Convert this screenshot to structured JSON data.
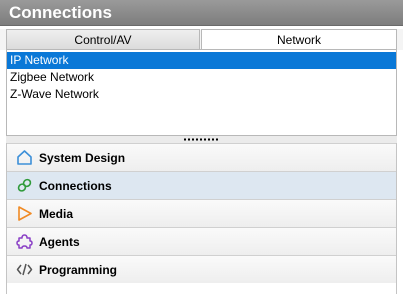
{
  "panel": {
    "title": "Connections"
  },
  "tabs": [
    {
      "label": "Control/AV",
      "active": false
    },
    {
      "label": "Network",
      "active": true
    }
  ],
  "network_list": [
    {
      "label": "IP Network",
      "selected": true
    },
    {
      "label": "Zigbee Network",
      "selected": false
    },
    {
      "label": "Z-Wave Network",
      "selected": false
    }
  ],
  "nav": [
    {
      "label": "System Design",
      "icon": "house-icon",
      "color": "#3c8fd8",
      "active": false
    },
    {
      "label": "Connections",
      "icon": "link-icon",
      "color": "#2f9a3a",
      "active": true
    },
    {
      "label": "Media",
      "icon": "play-icon",
      "color": "#f08a24",
      "active": false
    },
    {
      "label": "Agents",
      "icon": "puzzle-icon",
      "color": "#8a3fc6",
      "active": false
    },
    {
      "label": "Programming",
      "icon": "code-icon",
      "color": "#555555",
      "active": false
    }
  ],
  "colors": {
    "selection": "#0a78d7",
    "titlebar": "#8a8a8a"
  }
}
